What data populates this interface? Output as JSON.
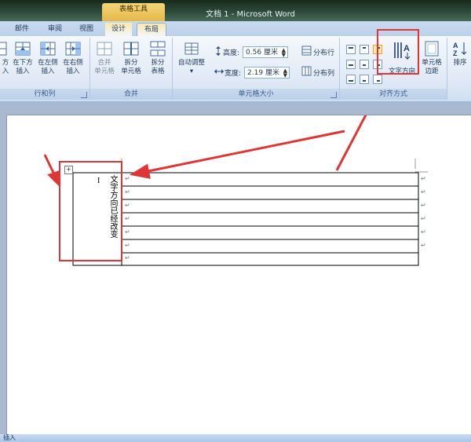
{
  "window": {
    "title": "文档 1 - Microsoft Word",
    "context_tab_header": "表格工具"
  },
  "tabs": [
    {
      "label": "邮件"
    },
    {
      "label": "审阅"
    },
    {
      "label": "视图"
    },
    {
      "label": "设计"
    },
    {
      "label": "布局"
    }
  ],
  "ribbon": {
    "rows_cols": {
      "label": "行和列",
      "buttons": [
        {
          "line1": "方",
          "line2": "入"
        },
        {
          "line1": "在下方",
          "line2": "插入"
        },
        {
          "line1": "在左侧",
          "line2": "插入"
        },
        {
          "line1": "在右侧",
          "line2": "插入"
        }
      ]
    },
    "merge": {
      "label": "合并",
      "buttons": [
        {
          "line1": "合并",
          "line2": "单元格"
        },
        {
          "line1": "拆分",
          "line2": "单元格"
        },
        {
          "line1": "拆分",
          "line2": "表格"
        }
      ]
    },
    "cell_size": {
      "label": "单元格大小",
      "autofit": {
        "line1": "自动调整",
        "line2": "▾"
      },
      "height_label": "高度:",
      "height_value": "0.56 厘米",
      "width_label": "宽度:",
      "width_value": "2.19 厘米",
      "distribute_rows": "分布行",
      "distribute_cols": "分布列"
    },
    "alignment": {
      "label": "对齐方式",
      "text_direction": "文字方向",
      "cell_margins": {
        "line1": "单元格",
        "line2": "边距"
      }
    },
    "data": {
      "sort": "排序"
    }
  },
  "document": {
    "vertical_text": "文字方向已经改变",
    "cursor_mark": "I",
    "move_handle": "+",
    "cell_mark": "↵"
  },
  "status": {
    "text": "插入"
  },
  "colors": {
    "annotation_red": "#e03535"
  }
}
